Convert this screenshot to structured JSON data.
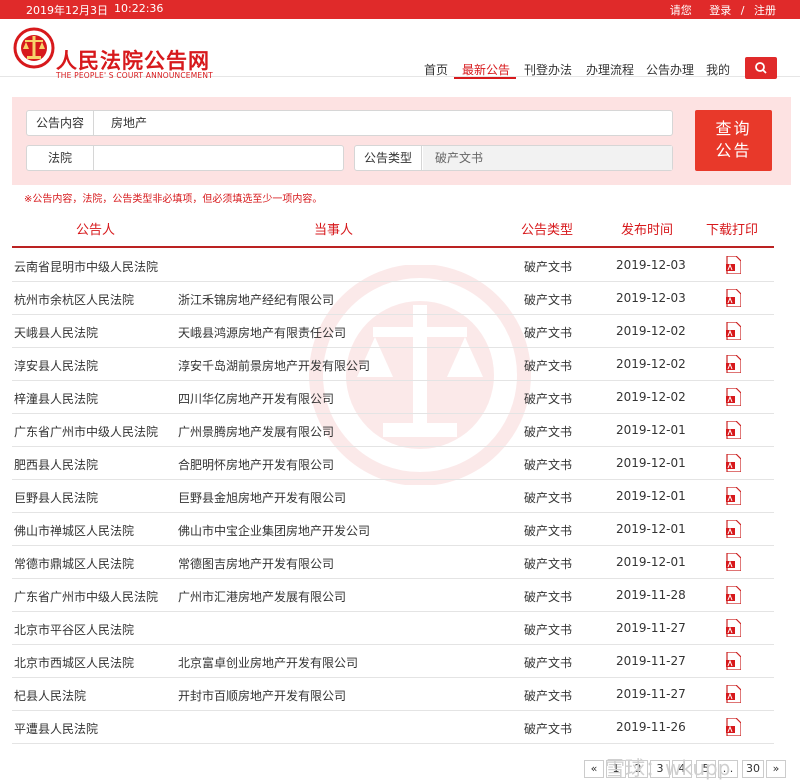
{
  "topbar": {
    "date": "2019年12月3日",
    "time": "10:22:36",
    "greeting": "请您",
    "login": "登录",
    "separator": "/",
    "register": "注册"
  },
  "header": {
    "title_cn": "人民法院公告网",
    "title_en": "THE PEOPLE' S COURT ANNOUNCEMENT",
    "nav": [
      "首页",
      "最新公告",
      "刊登办法",
      "办理流程",
      "公告办理",
      "我的"
    ],
    "active_nav": "最新公告"
  },
  "query": {
    "content_label": "公告内容",
    "content_value": "房地产",
    "court_label": "法院",
    "court_value": "",
    "type_label": "公告类型",
    "type_value": "破产文书",
    "submit_line1": "查询",
    "submit_line2": "公告",
    "note": "※公告内容，法院，公告类型非必填项，但必须填选至少一项内容。"
  },
  "table": {
    "headers": [
      "公告人",
      "当事人",
      "公告类型",
      "发布时间",
      "下载打印"
    ],
    "rows": [
      {
        "court": "云南省昆明市中级人民法院",
        "party": "",
        "type": "破产文书",
        "date": "2019-12-03"
      },
      {
        "court": "杭州市余杭区人民法院",
        "party": "浙江禾锦房地产经纪有限公司",
        "type": "破产文书",
        "date": "2019-12-03"
      },
      {
        "court": "天峨县人民法院",
        "party": "天峨县鸿源房地产有限责任公司",
        "type": "破产文书",
        "date": "2019-12-02"
      },
      {
        "court": "淳安县人民法院",
        "party": "淳安千岛湖前景房地产开发有限公司",
        "type": "破产文书",
        "date": "2019-12-02"
      },
      {
        "court": "梓潼县人民法院",
        "party": "四川华亿房地产开发有限公司",
        "type": "破产文书",
        "date": "2019-12-02"
      },
      {
        "court": "广东省广州市中级人民法院",
        "party": "广州景腾房地产发展有限公司",
        "type": "破产文书",
        "date": "2019-12-01"
      },
      {
        "court": "肥西县人民法院",
        "party": "合肥明怀房地产开发有限公司",
        "type": "破产文书",
        "date": "2019-12-01"
      },
      {
        "court": "巨野县人民法院",
        "party": "巨野县金旭房地产开发有限公司",
        "type": "破产文书",
        "date": "2019-12-01"
      },
      {
        "court": "佛山市禅城区人民法院",
        "party": "佛山市中宝企业集团房地产开发公司",
        "type": "破产文书",
        "date": "2019-12-01"
      },
      {
        "court": "常德市鼎城区人民法院",
        "party": "常德图吉房地产开发有限公司",
        "type": "破产文书",
        "date": "2019-12-01"
      },
      {
        "court": "广东省广州市中级人民法院",
        "party": "广州市汇港房地产发展有限公司",
        "type": "破产文书",
        "date": "2019-11-28"
      },
      {
        "court": "北京市平谷区人民法院",
        "party": "",
        "type": "破产文书",
        "date": "2019-11-27"
      },
      {
        "court": "北京市西城区人民法院",
        "party": "北京富卓创业房地产开发有限公司",
        "type": "破产文书",
        "date": "2019-11-27"
      },
      {
        "court": "杞县人民法院",
        "party": "开封市百顺房地产开发有限公司",
        "type": "破产文书",
        "date": "2019-11-27"
      },
      {
        "court": "平遭县人民法院",
        "party": "",
        "type": "破产文书",
        "date": "2019-11-26"
      }
    ]
  },
  "pagination": [
    "«",
    "1",
    "2",
    "3",
    "4",
    "5",
    "...",
    "30",
    "»"
  ],
  "watermark_text": "雪球：wkupp",
  "colors": {
    "brand": "#e02a2a",
    "panel": "#fde2e2",
    "header_text": "#d7191c"
  }
}
